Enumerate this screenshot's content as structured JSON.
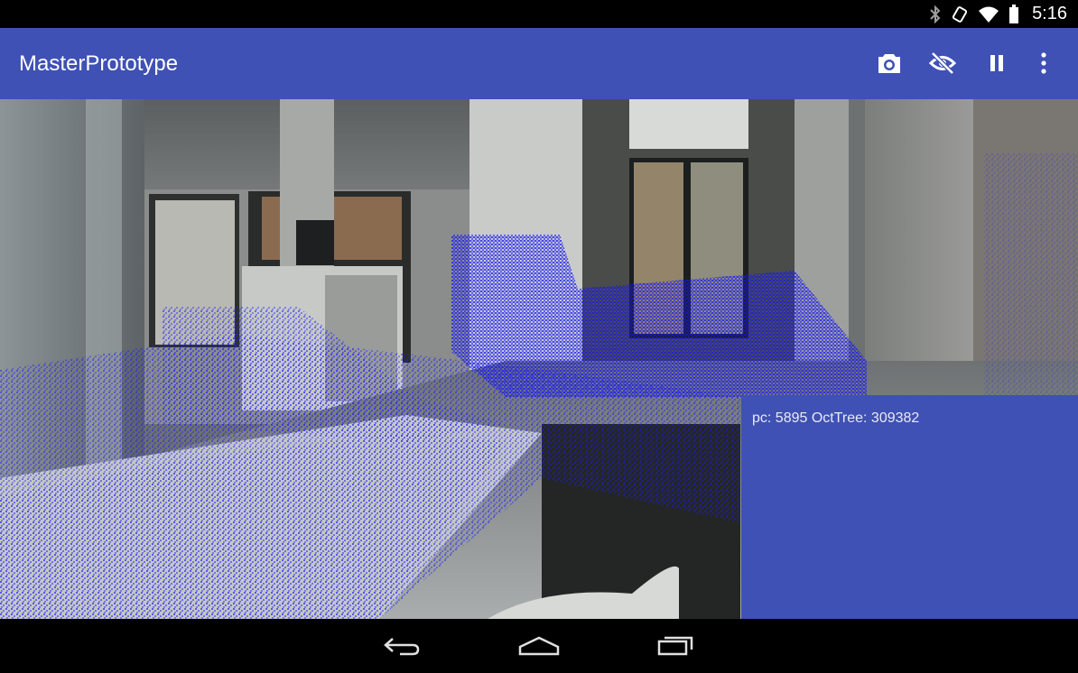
{
  "status_bar": {
    "time": "5:16",
    "icons": [
      "bluetooth-icon",
      "rotation-icon",
      "wifi-icon",
      "battery-icon"
    ]
  },
  "app_bar": {
    "title": "MasterPrototype",
    "color": "#3f51b5",
    "actions": [
      "camera-icon",
      "visibility-off-icon",
      "pause-icon",
      "more-vert-icon"
    ]
  },
  "info_panel": {
    "text": "pc: 5895 OctTree: 309382"
  },
  "nav_bar": {
    "buttons": [
      "back-icon",
      "home-icon",
      "recents-icon"
    ]
  },
  "colors": {
    "point_cloud": "#1a1aff",
    "panel": "#3f51b5"
  }
}
